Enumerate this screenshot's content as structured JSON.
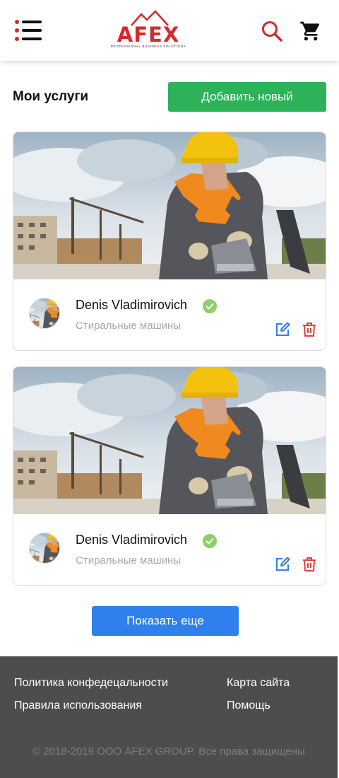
{
  "header": {
    "logo_text": "AFEX",
    "logo_tagline": "PROFESSIONAL BUSINESS SOLUTIONS",
    "icons": [
      "menu-icon",
      "search-icon",
      "cart-icon"
    ]
  },
  "colors": {
    "brand_red": "#d42a2a",
    "add_button": "#2db25a",
    "more_button": "#2f80ed",
    "footer_bg": "#4d4d4d",
    "verified": "#8fcf6a",
    "edit": "#2f80ed",
    "delete": "#e2403f"
  },
  "main": {
    "title": "Мои услуги",
    "add_button_label": "Добавить новый",
    "cards": [
      {
        "provider_name": "Denis Vladimirovich",
        "category": "Стиральные машины",
        "verified": true
      },
      {
        "provider_name": "Denis Vladimirovich",
        "category": "Стиральные машины",
        "verified": true
      }
    ],
    "show_more_label": "Показать еще"
  },
  "footer": {
    "links": [
      "Политика конфедецальности",
      "Карта сайта",
      "Правила использования",
      "Помощь"
    ],
    "copyright": "© 2018-2019 ООО AFEX GROUP. Все права защищены"
  }
}
